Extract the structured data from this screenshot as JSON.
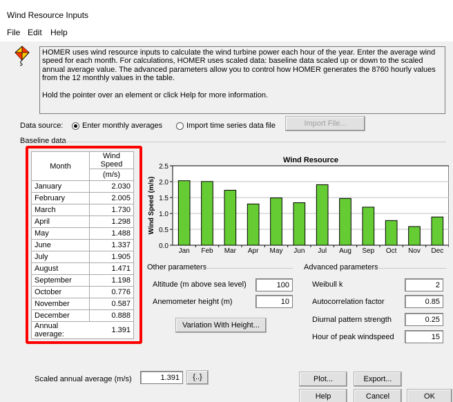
{
  "window": {
    "title": "Wind Resource Inputs"
  },
  "menu": {
    "items": [
      "File",
      "Edit",
      "Help"
    ]
  },
  "info": {
    "paragraph1": "HOMER uses wind resource inputs to calculate the wind turbine power each hour of the year. Enter the average wind speed for each month. For calculations, HOMER uses scaled data: baseline data scaled up or down to the scaled annual average value. The advanced parameters allow you to control how HOMER generates the 8760 hourly values from the 12 monthly values in the table.",
    "paragraph2": "Hold the pointer over an element or click Help for more information.",
    "icon": "kite-icon"
  },
  "data_source": {
    "label": "Data source:",
    "option_monthly": "Enter monthly averages",
    "option_timeseries": "Import time series data file",
    "selected": "Enter monthly averages",
    "import_button": "Import File..."
  },
  "baseline": {
    "group_label": "Baseline data",
    "col_month": "Month",
    "col_speed": "Wind Speed",
    "col_unit": "(m/s)",
    "rows": [
      {
        "month": "January",
        "speed": "2.030"
      },
      {
        "month": "February",
        "speed": "2.005"
      },
      {
        "month": "March",
        "speed": "1.730"
      },
      {
        "month": "April",
        "speed": "1.298"
      },
      {
        "month": "May",
        "speed": "1.488"
      },
      {
        "month": "June",
        "speed": "1.337"
      },
      {
        "month": "July",
        "speed": "1.905"
      },
      {
        "month": "August",
        "speed": "1.471"
      },
      {
        "month": "September",
        "speed": "1.198"
      },
      {
        "month": "October",
        "speed": "0.776"
      },
      {
        "month": "November",
        "speed": "0.587"
      },
      {
        "month": "December",
        "speed": "0.888"
      }
    ],
    "annual_label": "Annual average:",
    "annual_value": "1.391"
  },
  "chart_data": {
    "type": "bar",
    "title": "Wind Resource",
    "ylabel": "Wind Speed (m/s)",
    "xlabel": "",
    "categories": [
      "Jan",
      "Feb",
      "Mar",
      "Apr",
      "May",
      "Jun",
      "Jul",
      "Aug",
      "Sep",
      "Oct",
      "Nov",
      "Dec"
    ],
    "values": [
      2.03,
      2.005,
      1.73,
      1.298,
      1.488,
      1.337,
      1.905,
      1.471,
      1.198,
      0.776,
      0.587,
      0.888
    ],
    "yticks": [
      "0.0",
      "0.5",
      "1.0",
      "1.5",
      "2.0",
      "2.5"
    ],
    "ylim": [
      0,
      2.5
    ],
    "bar_color": "#66cc33",
    "grid": true
  },
  "other_params": {
    "group_label": "Other parameters",
    "altitude_label": "Altitude (m above sea level)",
    "altitude_value": "100",
    "anemometer_label": "Anemometer height (m)",
    "anemometer_value": "10",
    "variation_button": "Variation With Height..."
  },
  "advanced_params": {
    "group_label": "Advanced parameters",
    "weibull_label": "Weibull k",
    "weibull_value": "2",
    "autocorr_label": "Autocorrelation factor",
    "autocorr_value": "0.85",
    "diurnal_label": "Diurnal pattern strength",
    "diurnal_value": "0.25",
    "peak_label": "Hour of peak windspeed",
    "peak_value": "15"
  },
  "scaled": {
    "label": "Scaled annual average (m/s)",
    "value": "1.391",
    "sensitivity_button": "{..}"
  },
  "buttons": {
    "plot": "Plot...",
    "export": "Export...",
    "help": "Help",
    "cancel": "Cancel",
    "ok": "OK"
  },
  "highlight_color": "#ff0000"
}
